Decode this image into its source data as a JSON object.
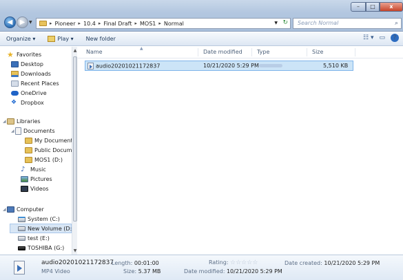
{
  "window": {
    "min_label": "–",
    "max_label": "□",
    "close_label": "x"
  },
  "address": {
    "breadcrumbs": [
      "Pioneer",
      "10.4",
      "Final Draft",
      "MOS1",
      "Normal"
    ]
  },
  "search": {
    "placeholder": "Search Normal"
  },
  "toolbar": {
    "organize": "Organize ▾",
    "play": "Play ▾",
    "new_folder": "New folder"
  },
  "sidebar": {
    "favorites": "Favorites",
    "desktop": "Desktop",
    "downloads": "Downloads",
    "recent": "Recent Places",
    "onedrive": "OneDrive",
    "dropbox": "Dropbox",
    "libraries": "Libraries",
    "documents": "Documents",
    "my_documents": "My Documents",
    "public_documents": "Public Docume",
    "mos1": "MOS1 (D:)",
    "music": "Music",
    "pictures": "Pictures",
    "videos": "Videos",
    "computer": "Computer",
    "system": "System (C:)",
    "new_volume": "New Volume (D:)",
    "test": "test (E:)",
    "toshiba": "TOSHIBA (G:)"
  },
  "columns": {
    "name": "Name",
    "date": "Date modified",
    "type": "Type",
    "size": "Size"
  },
  "file": {
    "name": "audio20201021172837",
    "date": "10/21/2020 5:29 PM",
    "size": "5,510 KB"
  },
  "details": {
    "name": "audio20201021172837",
    "type": "MP4 Video",
    "length_label": "Length:",
    "length": "00:01:00",
    "size_label": "Size:",
    "size": "5.37 MB",
    "rating_label": "Rating:",
    "rating_stars": "☆☆☆☆☆",
    "modified_label": "Date modified:",
    "modified": "10/21/2020 5:29 PM",
    "created_label": "Date created:",
    "created": "10/21/2020 5:29 PM"
  }
}
